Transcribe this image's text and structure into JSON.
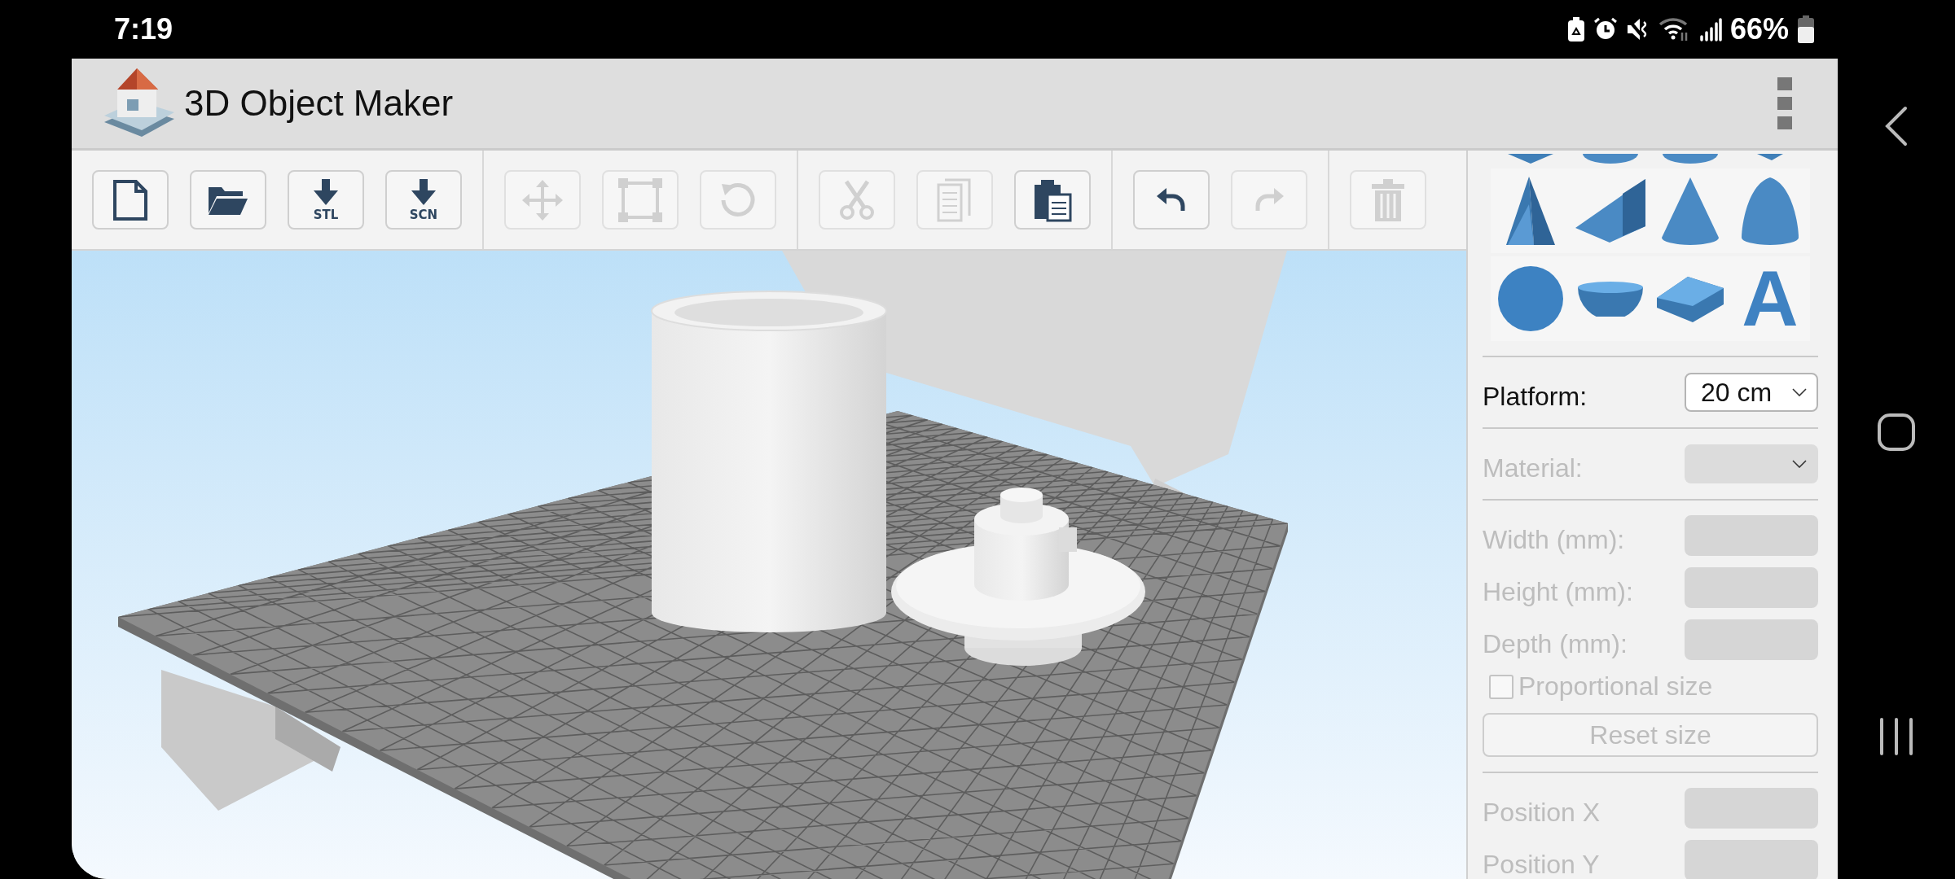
{
  "status_bar": {
    "time": "7:19",
    "battery_text": "66%"
  },
  "app_bar": {
    "title": "3D Object Maker"
  },
  "toolbar": {
    "groups": [
      [
        {
          "kind": "new",
          "disabled": false
        },
        {
          "kind": "open",
          "disabled": false
        },
        {
          "kind": "download",
          "label": "STL",
          "disabled": false
        },
        {
          "kind": "download",
          "label": "SCN",
          "disabled": false
        }
      ],
      [
        {
          "kind": "move",
          "disabled": true
        },
        {
          "kind": "scale",
          "disabled": true
        },
        {
          "kind": "rotate",
          "disabled": true
        }
      ],
      [
        {
          "kind": "cut",
          "disabled": true
        },
        {
          "kind": "copy",
          "disabled": true
        },
        {
          "kind": "paste",
          "disabled": false
        }
      ],
      [
        {
          "kind": "undo",
          "disabled": false
        },
        {
          "kind": "redo",
          "disabled": true
        }
      ],
      [
        {
          "kind": "delete",
          "disabled": true
        }
      ]
    ]
  },
  "side_panel": {
    "text_shape_letter": "A",
    "sections": [
      [
        {
          "kind": "select",
          "label": "Platform:",
          "value": "20 cm",
          "disabled": false
        }
      ],
      [
        {
          "kind": "select",
          "label": "Material:",
          "disabled": true
        }
      ],
      [
        {
          "kind": "input",
          "label": "Width (mm):",
          "disabled": true
        },
        {
          "kind": "input",
          "label": "Height (mm):",
          "disabled": true
        },
        {
          "kind": "input",
          "label": "Depth (mm):",
          "disabled": true
        },
        {
          "kind": "checkbox",
          "label": "Proportional size",
          "checked": false,
          "disabled": true
        },
        {
          "kind": "button",
          "label": "Reset size",
          "disabled": true
        }
      ],
      [
        {
          "kind": "input",
          "label": "Position X",
          "disabled": true
        },
        {
          "kind": "input",
          "label": "Position Y",
          "disabled": true
        }
      ]
    ]
  }
}
